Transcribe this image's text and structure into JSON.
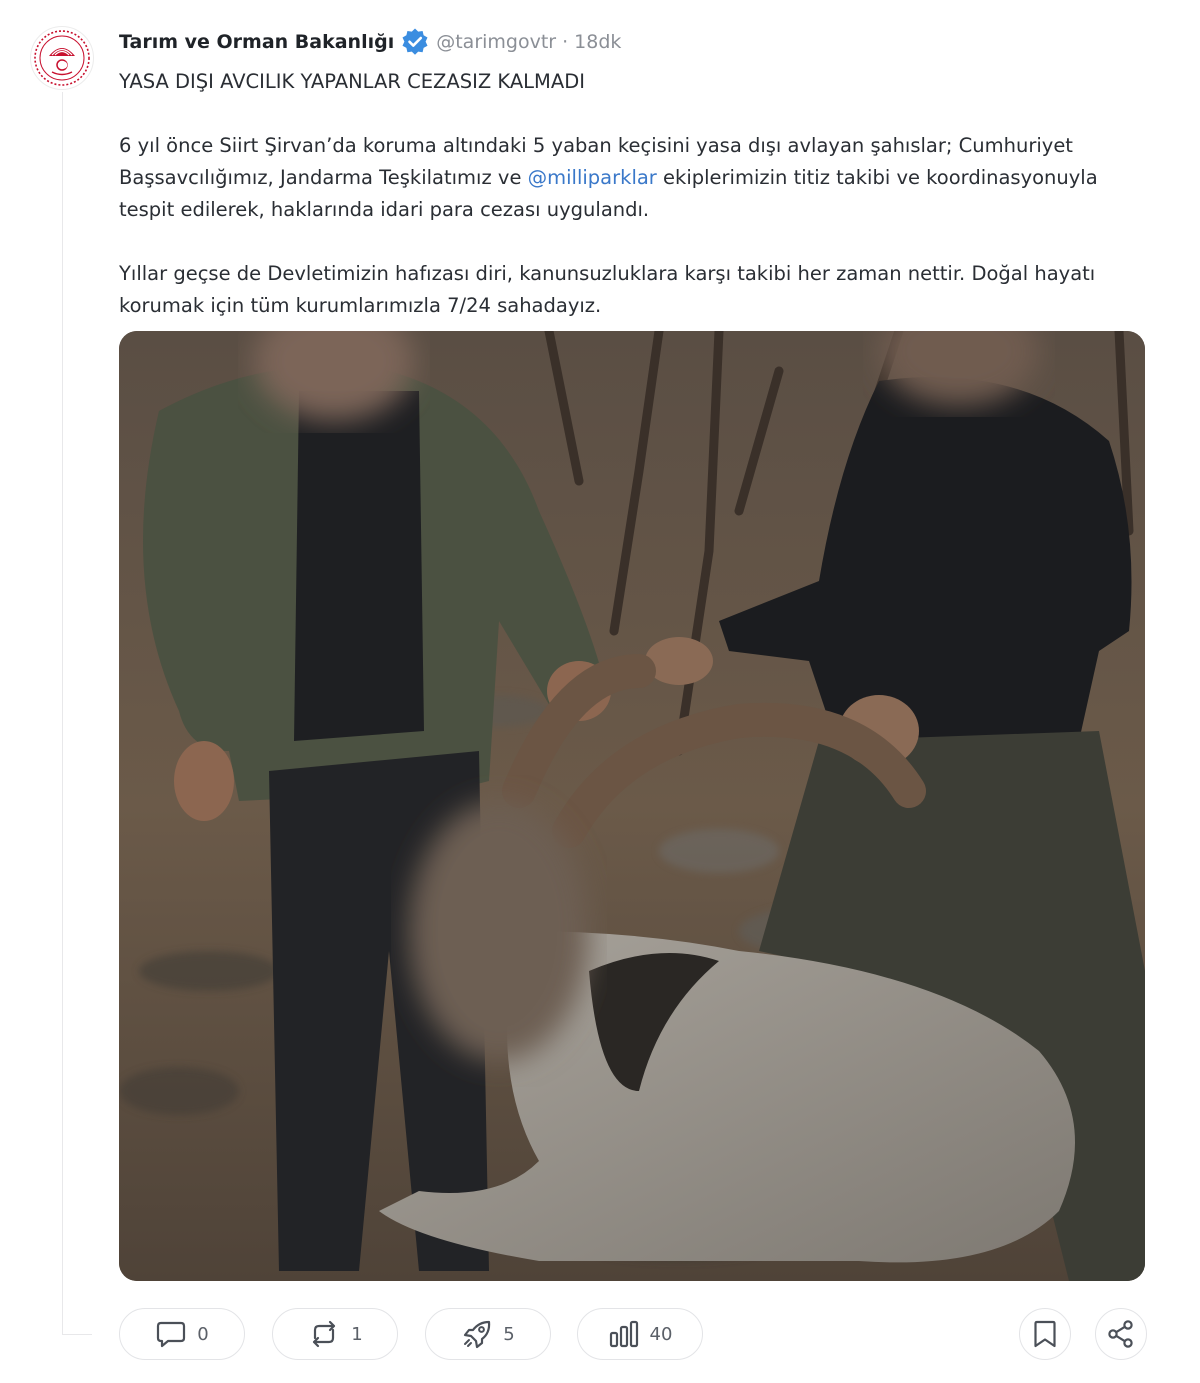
{
  "post": {
    "author_name": "Tarım ve Orman Bakanlığı",
    "handle": "@tarimgovtr",
    "separator": "·",
    "time": "18dk",
    "title_line": "YASA DIŞI AVCILIK YAPANLAR CEZASIZ KALMADI",
    "p2_before": "6 yıl önce Siirt Şirvan’da koruma altındaki 5 yaban keçisini yasa dışı avlayan şahıslar; Cumhuriyet Başsavcılığımız, Jandarma Teşkilatımız ve ",
    "mention": "@milliparklar",
    "p2_after": " ekiplerimizin titiz takibi ve koordinasyonuyla tespit edilerek, haklarında idari para cezası uygulandı.",
    "p3": "Yıllar geçse de Devletimizin hafızası diri, kanunsuzluklara karşı takibi her zaman nettir. Doğal hayatı korumak için tüm kurumlarımızla 7/24 sahadayız."
  },
  "actions": {
    "replies": "0",
    "reposts": "1",
    "boosts": "5",
    "views": "40"
  },
  "icons": {
    "verified": "verified-badge-icon",
    "reply": "comment-icon",
    "repost": "repost-icon",
    "boost": "rocket-icon",
    "views": "bar-chart-icon",
    "bookmark": "bookmark-icon",
    "share": "share-icon"
  },
  "colors": {
    "accent": "#3a78c9",
    "verified": "#3b8de0",
    "logo_red": "#c8102e"
  }
}
